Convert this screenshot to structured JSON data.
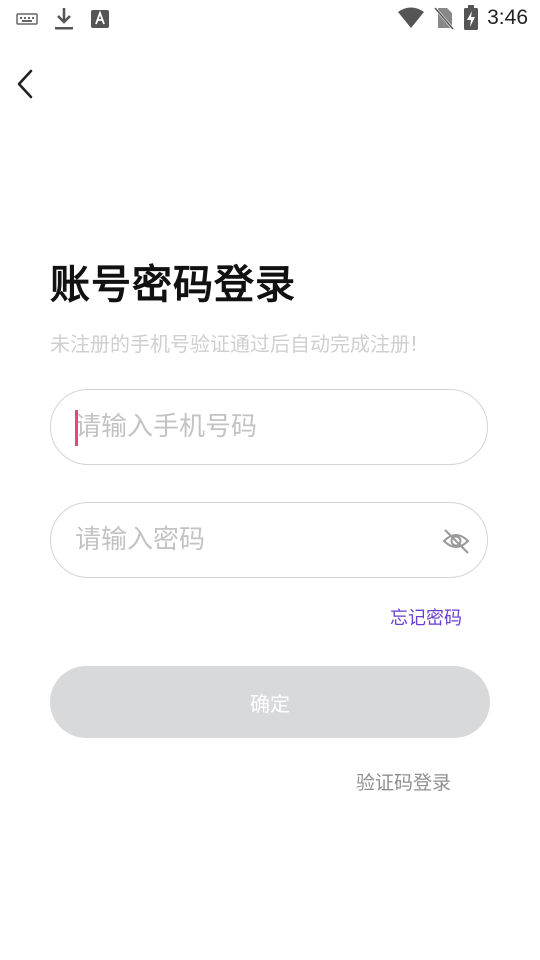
{
  "status_bar": {
    "time": "3:46",
    "left_icons": [
      "keyboard-icon",
      "download-icon",
      "font-app-icon"
    ],
    "right_icons": [
      "wifi-icon",
      "no-sim-icon",
      "battery-charging-icon"
    ]
  },
  "nav": {
    "back_icon": "chevron-left-icon"
  },
  "login": {
    "title": "账号密码登录",
    "subtitle": "未注册的手机号验证通过后自动完成注册!",
    "phone_placeholder": "请输入手机号码",
    "password_placeholder": "请输入密码",
    "visibility_icon": "eye-off-icon",
    "forgot_label": "忘记密码",
    "confirm_label": "确定",
    "code_login_label": "验证码登录"
  },
  "colors": {
    "accent": "#6a3ed1",
    "caret": "#e8467a",
    "button_disabled": "#d8d9db",
    "placeholder": "#c3c3c3"
  }
}
